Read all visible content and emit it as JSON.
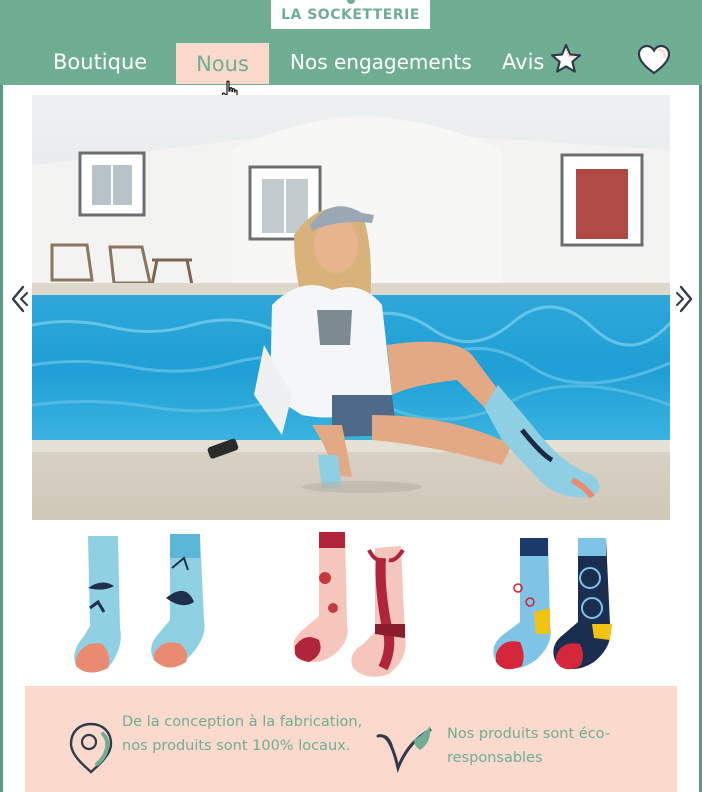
{
  "brand": {
    "logo_text": "LA SOCKETTERIE"
  },
  "nav": {
    "items": [
      {
        "label": "Boutique"
      },
      {
        "label": "Nous",
        "active": true
      },
      {
        "label": "Nos engagements"
      },
      {
        "label": "Avis"
      }
    ],
    "icons": {
      "avis": "star-icon",
      "wishlist": "heart-icon"
    }
  },
  "hero": {
    "icons": {
      "prev": "chevron-left-icon",
      "next": "chevron-right-icon"
    }
  },
  "products": [
    {
      "icon": "ocean-whale-socks"
    },
    {
      "icon": "lobster-socks"
    },
    {
      "icon": "bicycle-socks"
    }
  ],
  "features": [
    {
      "icon": "location-pin-icon",
      "text": "De la conception à la fabrication, nos produits sont 100% locaux."
    },
    {
      "icon": "vegan-icon",
      "text": "Nos produits sont éco-responsables"
    }
  ],
  "colors": {
    "brand_green": "#6fae93",
    "blush_pink": "#fbd9cd",
    "text_dark": "#2f3b4a"
  }
}
